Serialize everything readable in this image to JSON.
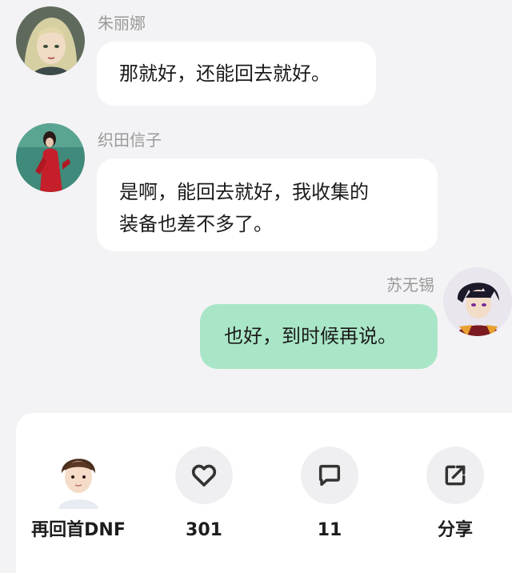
{
  "messages": [
    {
      "sender": "朱丽娜",
      "text": "那就好，还能回去就好。",
      "side": "left",
      "avatar_icon": "anime-woman-blonde-avatar"
    },
    {
      "sender": "织田信子",
      "text": "是啊，能回去就好，我收集的装备也差不多了。",
      "line1": "是啊，能回去就好，我收集的",
      "line2": "装备也差不多了。",
      "side": "left",
      "avatar_icon": "woman-red-dress-avatar"
    },
    {
      "sender": "苏无锡",
      "text": "也好，到时候再说。",
      "side": "right",
      "avatar_icon": "anime-man-dark-hair-avatar"
    }
  ],
  "colors": {
    "background": "#f3f3f5",
    "bubble_left": "#ffffff",
    "bubble_right": "#a9e6c7",
    "sender_text": "#9a9a9a"
  },
  "footer": {
    "author": {
      "label": "再回首DNF",
      "icon": "author-avatar"
    },
    "like": {
      "count": "301",
      "icon": "heart-icon"
    },
    "comment": {
      "count": "11",
      "icon": "comment-icon"
    },
    "share": {
      "label": "分享",
      "icon": "share-icon"
    }
  }
}
